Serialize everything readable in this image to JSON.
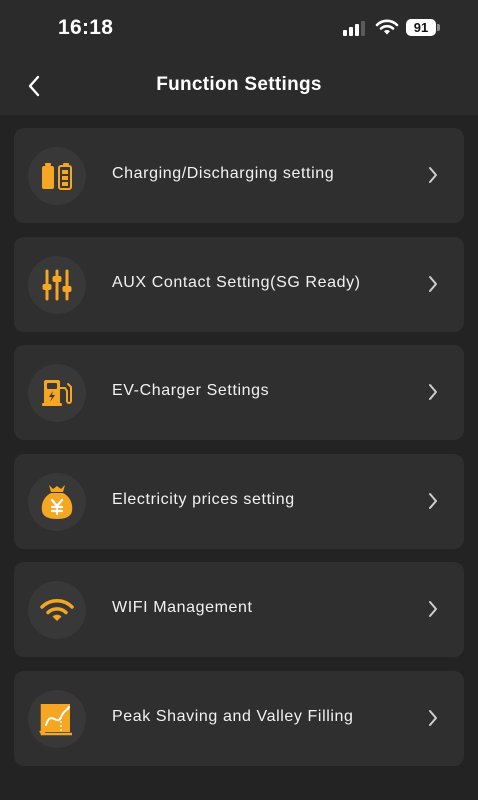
{
  "status_bar": {
    "time": "16:18",
    "battery_level": "91"
  },
  "header": {
    "title": "Function Settings",
    "back_icon": "chevron-left-icon"
  },
  "accent_color": "#f5a623",
  "menu": [
    {
      "label": "Charging/Discharging setting",
      "icon": "battery-charge-icon"
    },
    {
      "label": "AUX Contact Setting(SG Ready)",
      "icon": "sliders-icon"
    },
    {
      "label": "EV-Charger Settings",
      "icon": "ev-charger-icon"
    },
    {
      "label": "Electricity prices setting",
      "icon": "money-bag-icon"
    },
    {
      "label": "WIFI Management",
      "icon": "wifi-icon"
    },
    {
      "label": "Peak Shaving and Valley Filling",
      "icon": "curve-chart-icon"
    }
  ]
}
